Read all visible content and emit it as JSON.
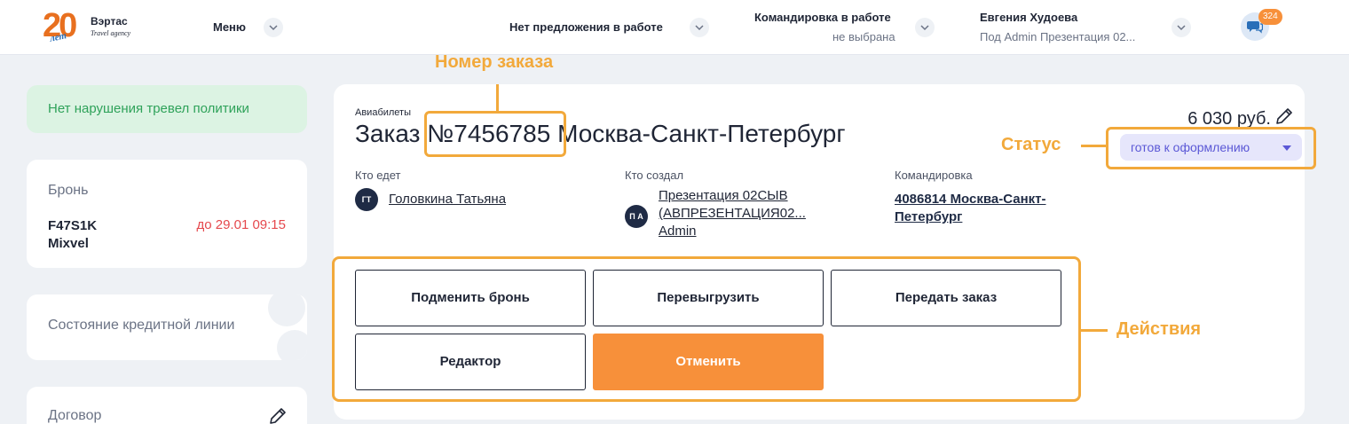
{
  "header": {
    "logo_number": "20",
    "logo_years": "лет",
    "logo_name": "Вэртас",
    "logo_sub": "Travel agency",
    "menu_label": "Меню",
    "offer_label": "Нет предложения в работе",
    "trip_label": "Командировка в работе",
    "trip_value": "не выбрана",
    "user_name": "Евгения Худоева",
    "user_sub": "Под Admin Презентация 02...",
    "chat_count": "324"
  },
  "sidebar": {
    "policy_text": "Нет нарушения тревел политики",
    "booking_title": "Бронь",
    "booking_code": "F47S1K",
    "booking_system": "Mixvel",
    "booking_deadline": "до 29.01 09:15",
    "credit_title": "Состояние кредитной линии",
    "contract_title": "Договор"
  },
  "order": {
    "category": "Авиабилеты",
    "title_prefix": "Заказ",
    "number": "№7456785",
    "route": "Москва-Санкт-Петербург",
    "price": "6 030 руб.",
    "status": "готов к оформлению",
    "traveler_label": "Кто едет",
    "traveler_initials": "ГТ",
    "traveler_name": "Головкина Татьяна",
    "creator_label": "Кто создал",
    "creator_initials": "П А",
    "creator_line1": "Презентация 02СЫВ",
    "creator_line2": "(АВПРЕЗЕНТАЦИЯ02...",
    "creator_line3": "Admin",
    "trip_label": "Командировка",
    "trip_line1": "4086814 Москва-Санкт-",
    "trip_line2": "Петербург"
  },
  "actions": {
    "replace_booking": "Подменить бронь",
    "reupload": "Перевыгрузить",
    "transfer_order": "Передать заказ",
    "editor": "Редактор",
    "cancel": "Отменить"
  },
  "annotations": {
    "order_number": "Номер заказа",
    "status": "Статус",
    "actions": "Действия"
  },
  "colors": {
    "accent_orange": "#f7903a",
    "annotation": "#f2a93b",
    "status_bg": "#e6e6fb",
    "status_text": "#5b58d6",
    "policy_bg": "#dcf3e3",
    "policy_text": "#2fa25a",
    "deadline_red": "#e5484d"
  }
}
